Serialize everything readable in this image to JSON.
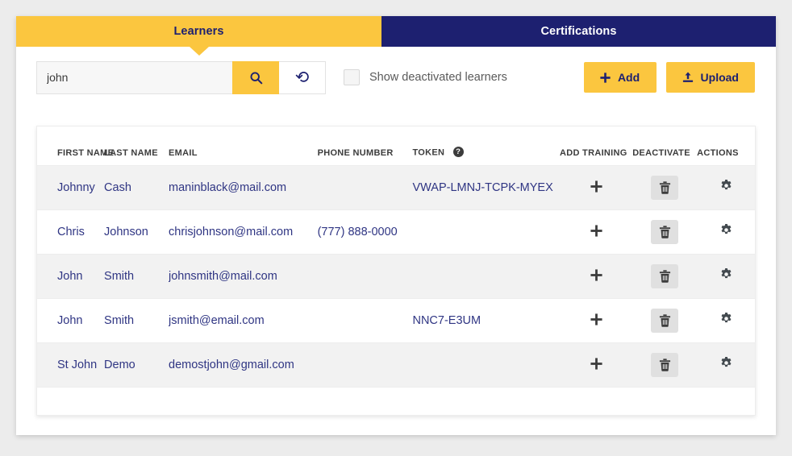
{
  "tabs": [
    {
      "label": "Learners",
      "active": true
    },
    {
      "label": "Certifications",
      "active": false
    }
  ],
  "toolbar": {
    "search_value": "john",
    "search_placeholder": "Search",
    "search_icon": "search-icon",
    "reset_icon": "reset-icon",
    "checkbox_label": "Show deactivated learners",
    "checkbox_checked": false,
    "add_label": "Add",
    "add_icon": "plus-icon",
    "upload_label": "Upload",
    "upload_icon": "upload-icon"
  },
  "table": {
    "headers": {
      "first_name": "FIRST NAME",
      "last_name": "LAST NAME",
      "email": "EMAIL",
      "phone": "PHONE NUMBER",
      "token": "TOKEN",
      "token_help": "?",
      "add_training": "ADD TRAINING",
      "deactivate": "DEACTIVATE",
      "actions": "ACTIONS"
    },
    "rows": [
      {
        "first_name": "Johnny",
        "last_name": "Cash",
        "email": "maninblack@mail.com",
        "phone": "",
        "token": "VWAP-LMNJ-TCPK-MYEX",
        "shaded": true
      },
      {
        "first_name": "Chris",
        "last_name": "Johnson",
        "email": "chrisjohnson@mail.com",
        "phone": "(777) 888-0000",
        "token": "",
        "shaded": false
      },
      {
        "first_name": "John",
        "last_name": "Smith",
        "email": "johnsmith@mail.com",
        "phone": "",
        "token": "",
        "shaded": true
      },
      {
        "first_name": "John",
        "last_name": "Smith",
        "email": "jsmith@email.com",
        "phone": "",
        "token": "NNC7-E3UM",
        "shaded": false
      },
      {
        "first_name": "St John",
        "last_name": "Demo",
        "email": "demostjohn@gmail.com",
        "phone": "",
        "token": "",
        "shaded": true
      }
    ]
  },
  "colors": {
    "accent_yellow": "#fbc63f",
    "navy": "#1d2070",
    "text_navy": "#2f3583",
    "page_bg": "#ececec",
    "row_shaded": "#f2f2f2"
  }
}
